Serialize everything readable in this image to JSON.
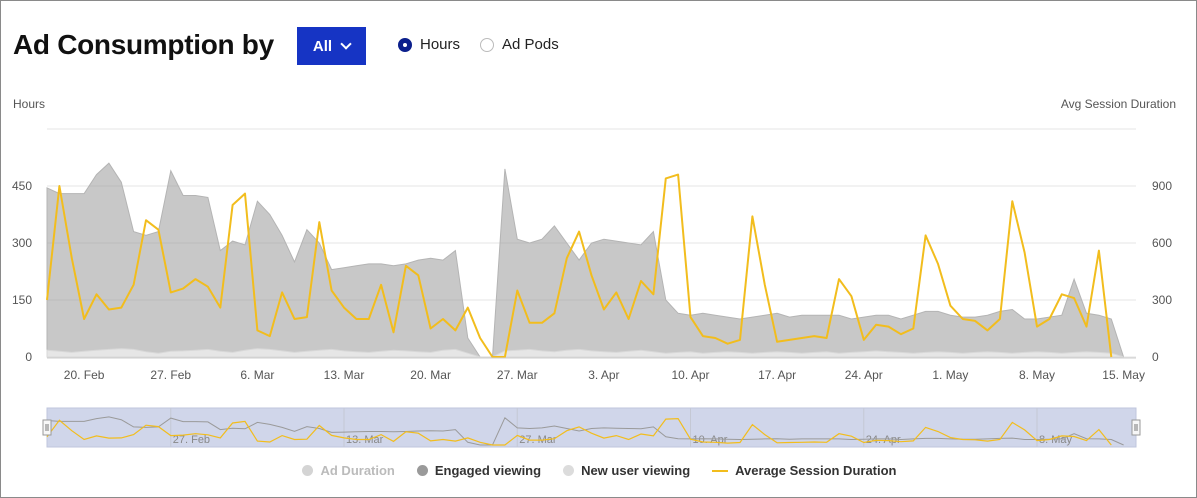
{
  "header": {
    "title": "Ad Consumption by",
    "dropdown_label": "All",
    "radio_options": [
      {
        "label": "Hours",
        "selected": true
      },
      {
        "label": "Ad Pods",
        "selected": false
      }
    ]
  },
  "colors": {
    "accent": "#1634c4",
    "ad_duration": "#d9d9d9",
    "engaged_viewing": "#c6c6c6",
    "new_user_viewing": "#e3e3e3",
    "avg_session": "#f2bd1d",
    "navigator_bg": "#d0d6ea"
  },
  "chart_data": {
    "type": "area",
    "ylabel": "Hours",
    "y2label": "Avg Session Duration",
    "ylim": [
      0,
      600
    ],
    "y2lim": [
      0,
      1200
    ],
    "yticks": [
      "0",
      "150",
      "300",
      "450"
    ],
    "y2ticks": [
      "0",
      "300",
      "600",
      "900"
    ],
    "xlim": [
      "2023-02-17",
      "2023-05-16"
    ],
    "xticks": [
      "20. Feb",
      "27. Feb",
      "6. Mar",
      "13. Mar",
      "20. Mar",
      "27. Mar",
      "3. Apr",
      "10. Apr",
      "17. Apr",
      "24. Apr",
      "1. May",
      "8. May",
      "15. May"
    ],
    "navigator_ticks": [
      "27. Feb",
      "13. Mar",
      "27. Mar",
      "10. Apr",
      "24. Apr",
      "8. May"
    ],
    "legend": [
      {
        "name": "Ad Duration",
        "style": "dot",
        "color": "#d4d4d4",
        "dim": true
      },
      {
        "name": "Engaged viewing",
        "style": "dot",
        "color": "#9a9a9a",
        "dim": false
      },
      {
        "name": "New user viewing",
        "style": "dot",
        "color": "#dcdcdc",
        "dim": false
      },
      {
        "name": "Average Session Duration",
        "style": "line",
        "color": "#f2bd1d",
        "dim": false
      }
    ],
    "x": [
      "2023-02-17",
      "2023-02-18",
      "2023-02-19",
      "2023-02-20",
      "2023-02-21",
      "2023-02-22",
      "2023-02-23",
      "2023-02-24",
      "2023-02-25",
      "2023-02-26",
      "2023-02-27",
      "2023-02-28",
      "2023-03-01",
      "2023-03-02",
      "2023-03-03",
      "2023-03-04",
      "2023-03-05",
      "2023-03-06",
      "2023-03-07",
      "2023-03-08",
      "2023-03-09",
      "2023-03-10",
      "2023-03-11",
      "2023-03-12",
      "2023-03-13",
      "2023-03-14",
      "2023-03-15",
      "2023-03-16",
      "2023-03-17",
      "2023-03-18",
      "2023-03-19",
      "2023-03-20",
      "2023-03-21",
      "2023-03-22",
      "2023-03-23",
      "2023-03-24",
      "2023-03-25",
      "2023-03-26",
      "2023-03-27",
      "2023-03-28",
      "2023-03-29",
      "2023-03-30",
      "2023-03-31",
      "2023-04-01",
      "2023-04-02",
      "2023-04-03",
      "2023-04-04",
      "2023-04-05",
      "2023-04-06",
      "2023-04-07",
      "2023-04-08",
      "2023-04-09",
      "2023-04-10",
      "2023-04-11",
      "2023-04-12",
      "2023-04-13",
      "2023-04-14",
      "2023-04-15",
      "2023-04-16",
      "2023-04-17",
      "2023-04-18",
      "2023-04-19",
      "2023-04-20",
      "2023-04-21",
      "2023-04-22",
      "2023-04-23",
      "2023-04-24",
      "2023-04-25",
      "2023-04-26",
      "2023-04-27",
      "2023-04-28",
      "2023-04-29",
      "2023-04-30",
      "2023-05-01",
      "2023-05-02",
      "2023-05-03",
      "2023-05-04",
      "2023-05-05",
      "2023-05-06",
      "2023-05-07",
      "2023-05-08",
      "2023-05-09",
      "2023-05-10",
      "2023-05-11",
      "2023-05-12",
      "2023-05-13",
      "2023-05-14",
      "2023-05-15"
    ],
    "series": [
      {
        "name": "Engaged viewing",
        "axis": "left",
        "values": [
          445,
          430,
          430,
          430,
          480,
          510,
          460,
          330,
          320,
          330,
          490,
          425,
          425,
          420,
          280,
          305,
          295,
          410,
          375,
          320,
          250,
          335,
          300,
          230,
          235,
          240,
          245,
          245,
          240,
          245,
          255,
          260,
          255,
          280,
          50,
          0,
          0,
          495,
          310,
          300,
          310,
          345,
          300,
          255,
          300,
          310,
          305,
          300,
          295,
          330,
          150,
          115,
          110,
          115,
          110,
          105,
          100,
          105,
          110,
          115,
          105,
          110,
          110,
          110,
          110,
          100,
          105,
          110,
          110,
          100,
          110,
          120,
          120,
          110,
          105,
          105,
          110,
          120,
          125,
          100,
          100,
          105,
          110,
          205,
          115,
          110,
          100,
          0
        ]
      },
      {
        "name": "New user viewing",
        "axis": "left",
        "values": [
          18,
          15,
          12,
          15,
          18,
          20,
          22,
          20,
          14,
          10,
          15,
          16,
          18,
          20,
          15,
          12,
          18,
          22,
          20,
          16,
          12,
          15,
          18,
          20,
          16,
          14,
          12,
          15,
          18,
          16,
          14,
          12,
          18,
          20,
          10,
          0,
          0,
          16,
          18,
          20,
          16,
          14,
          18,
          20,
          16,
          14,
          12,
          15,
          18,
          14,
          10,
          12,
          14,
          10,
          12,
          14,
          12,
          10,
          12,
          14,
          12,
          10,
          12,
          14,
          10,
          12,
          14,
          16,
          14,
          12,
          10,
          12,
          14,
          12,
          10,
          12,
          14,
          12,
          10,
          12,
          14,
          12,
          10,
          12,
          14,
          12,
          10,
          0
        ]
      },
      {
        "name": "Average Session Duration",
        "axis": "right",
        "values": [
          300,
          900,
          520,
          200,
          330,
          250,
          260,
          380,
          720,
          670,
          340,
          360,
          410,
          370,
          260,
          800,
          860,
          140,
          110,
          340,
          200,
          210,
          710,
          350,
          260,
          200,
          200,
          380,
          130,
          480,
          430,
          150,
          200,
          140,
          260,
          100,
          0,
          0,
          350,
          180,
          180,
          230,
          520,
          660,
          430,
          250,
          340,
          200,
          400,
          330,
          940,
          960,
          210,
          110,
          100,
          70,
          90,
          740,
          380,
          80,
          90,
          100,
          110,
          100,
          410,
          320,
          90,
          170,
          160,
          120,
          150,
          640,
          490,
          270,
          200,
          190,
          140,
          200,
          820,
          550,
          160,
          200,
          330,
          310,
          160,
          560,
          0
        ]
      }
    ]
  }
}
